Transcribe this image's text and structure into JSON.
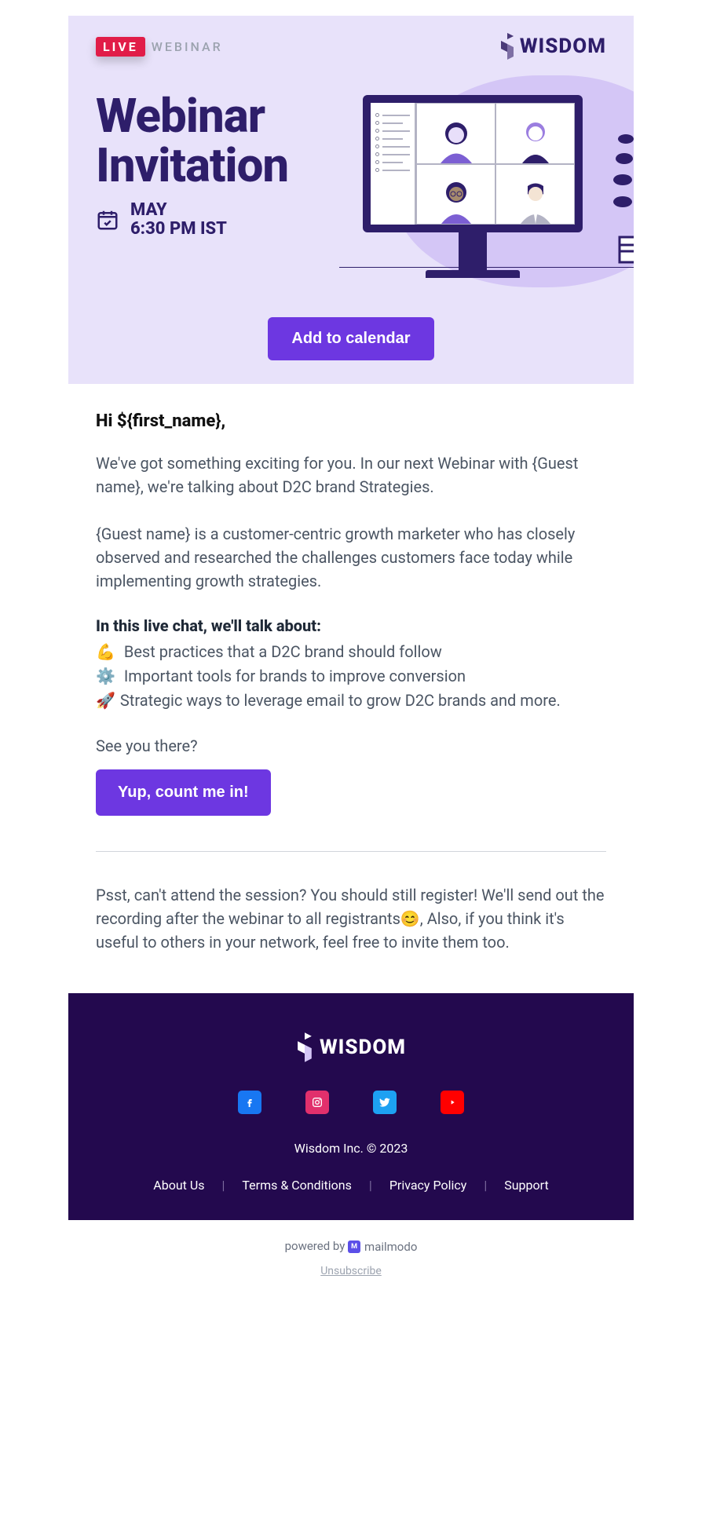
{
  "header": {
    "live_badge": "LIVE",
    "webinar_label": "WEBINAR",
    "brand": "WISDOM"
  },
  "hero": {
    "title_line1": "Webinar",
    "title_line2": "Invitation",
    "date_month": "MAY",
    "date_time": "6:30 PM IST",
    "cta": "Add to calendar"
  },
  "body": {
    "greeting": "Hi ${first_name},",
    "para1": "We've got something exciting for you. In our next Webinar with {Guest name}, we're talking about D2C brand Strategies.",
    "para2": "{Guest name} is a customer-centric growth marketer who has closely observed and researched the challenges customers face today while implementing growth strategies.",
    "topics_heading": "In this live chat, we'll talk about:",
    "topics": [
      {
        "emoji": "💪",
        "text": " Best practices that a D2C brand should follow"
      },
      {
        "emoji": "⚙️",
        "text": " Important tools for brands to improve conversion"
      },
      {
        "emoji": "🚀",
        "text": "Strategic ways to leverage email to grow D2C brands and more."
      }
    ],
    "closing_q": "See you there?",
    "cta2": "Yup, count me in!",
    "ps": "Psst, can't attend the session? You should still register! We'll send out the recording after the webinar to all registrants😊, Also, if you think it's useful to others in your network, feel free to invite them too."
  },
  "footer": {
    "brand": "WISDOM",
    "copyright": "Wisdom Inc. © 2023",
    "links": [
      "About Us",
      "Terms & Conditions",
      "Privacy Policy",
      "Support"
    ],
    "powered_prefix": "powered by ",
    "powered_brand": "mailmodo",
    "unsubscribe": "Unsubscribe"
  }
}
